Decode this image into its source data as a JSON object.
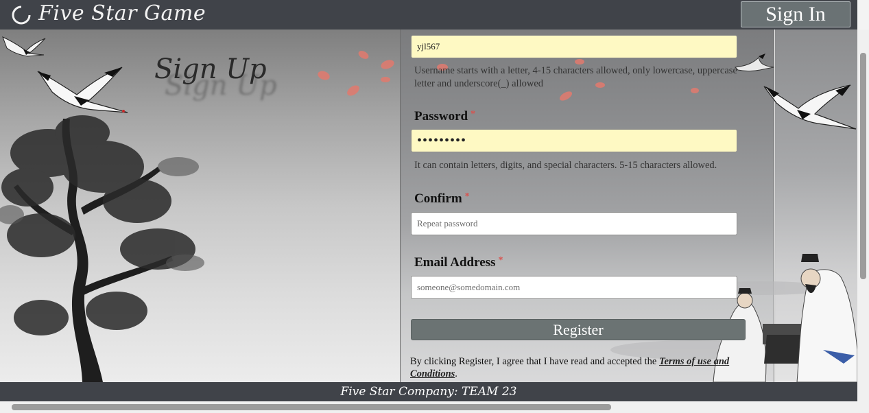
{
  "header": {
    "brand": "Five Star Game",
    "signin_label": "Sign In"
  },
  "signup": {
    "title": "Sign Up"
  },
  "form": {
    "username": {
      "value": "yjl567",
      "help": "Username starts with a letter, 4-15 characters allowed, only lowercase, uppercase letter and underscore(_) allowed"
    },
    "password": {
      "label": "Password",
      "required_mark": "*",
      "value": "abcdefghi",
      "help": "It can contain letters, digits, and special characters. 5-15 characters allowed."
    },
    "confirm": {
      "label": "Confirm",
      "required_mark": "*",
      "placeholder": "Repeat password"
    },
    "email": {
      "label": "Email Address",
      "required_mark": "*",
      "placeholder": "someone@somedomain.com"
    },
    "register_label": "Register",
    "terms_prefix": "By clicking Register, I agree that I have read and accepted the ",
    "terms_link": "Terms of use and Conditions",
    "terms_suffix": "."
  },
  "footer": {
    "text": "Five Star Company: TEAM 23"
  },
  "colors": {
    "header_bg": "#404349",
    "input_filled_bg": "#fef9c3",
    "button_bg": "#6b7373",
    "required": "#d9534f"
  }
}
